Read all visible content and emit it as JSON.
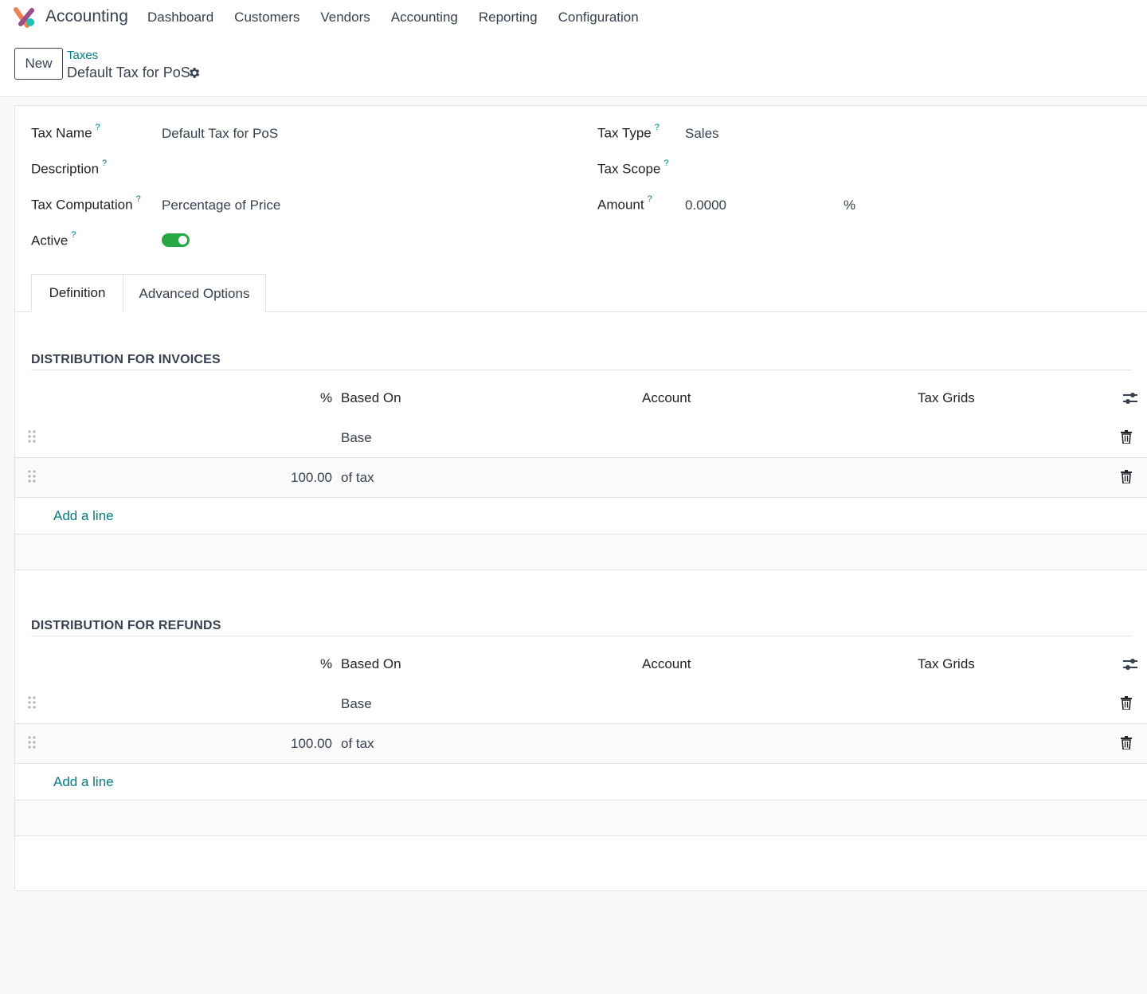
{
  "app": {
    "name": "Accounting"
  },
  "menu": [
    "Dashboard",
    "Customers",
    "Vendors",
    "Accounting",
    "Reporting",
    "Configuration"
  ],
  "control": {
    "new_label": "New",
    "breadcrumb": "Taxes",
    "title": "Default Tax for PoS"
  },
  "form": {
    "tax_name_label": "Tax Name",
    "tax_name_value": "Default Tax for PoS",
    "description_label": "Description",
    "tax_computation_label": "Tax Computation",
    "tax_computation_value": "Percentage of Price",
    "active_label": "Active",
    "active_value": true,
    "tax_type_label": "Tax Type",
    "tax_type_value": "Sales",
    "tax_scope_label": "Tax Scope",
    "amount_label": "Amount",
    "amount_value": "0.0000",
    "amount_unit": "%",
    "help_mark": "?"
  },
  "tabs": [
    "Definition",
    "Advanced Options"
  ],
  "invoices": {
    "title": "DISTRIBUTION FOR INVOICES",
    "headers": {
      "pct": "%",
      "based_on": "Based On",
      "account": "Account",
      "tax_grids": "Tax Grids"
    },
    "rows": [
      {
        "pct": "",
        "based_on": "Base"
      },
      {
        "pct": "100.00",
        "based_on": "of tax"
      }
    ],
    "add_line": "Add a line"
  },
  "refunds": {
    "title": "DISTRIBUTION FOR REFUNDS",
    "headers": {
      "pct": "%",
      "based_on": "Based On",
      "account": "Account",
      "tax_grids": "Tax Grids"
    },
    "rows": [
      {
        "pct": "",
        "based_on": "Base"
      },
      {
        "pct": "100.00",
        "based_on": "of tax"
      }
    ],
    "add_line": "Add a line"
  },
  "colors": {
    "accent": "#017e84",
    "toggle_on": "#28a745"
  }
}
